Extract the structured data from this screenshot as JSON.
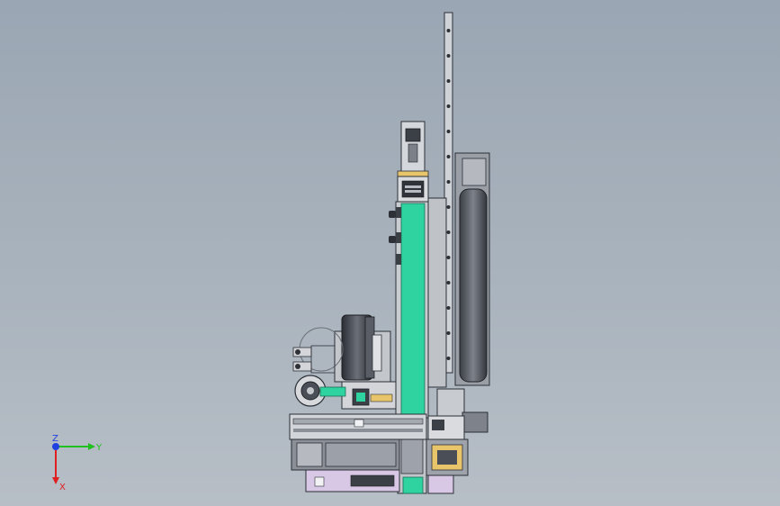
{
  "scene": {
    "type": "cad-assembly-side-view",
    "colors": {
      "background_top": "#9aa6b3",
      "background_bottom": "#b7bec6",
      "rail_fill": "#c9ccd1",
      "rail_edge": "#2b2f36",
      "column_accent": "#2fd3a0",
      "housing_dark": "#4a4e56",
      "housing_mid": "#8a8f98",
      "panel_pink": "#d8c8e6",
      "label_yellow": "#e8c46a"
    }
  },
  "triad": {
    "x_label": "X",
    "y_label": "Y",
    "z_label": "Z",
    "x_color": "#e02020",
    "y_color": "#20c020",
    "z_color": "#2040e0"
  }
}
